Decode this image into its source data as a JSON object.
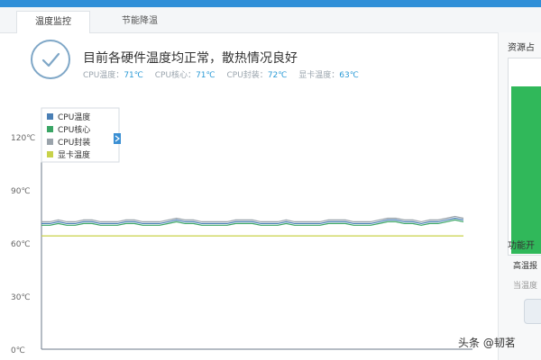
{
  "subtabs": [
    "温度监控",
    "节能降温"
  ],
  "status": {
    "message": "目前各硬件温度均正常，散热情况良好",
    "readings": [
      {
        "label": "CPU温度：",
        "value": "71℃"
      },
      {
        "label": "CPU核心：",
        "value": "71℃"
      },
      {
        "label": "CPU封装：",
        "value": "72℃"
      },
      {
        "label": "显卡温度：",
        "value": "63℃"
      }
    ]
  },
  "right_panel": {
    "title": "资源占",
    "title2": "功能开",
    "item1": "高温报",
    "item2": "当温度"
  },
  "watermark": "头条 @韧茗",
  "chart_data": {
    "type": "line",
    "ytick_labels": [
      "120℃",
      "90℃",
      "60℃",
      "30℃",
      "0℃"
    ],
    "ylim": [
      0,
      120
    ],
    "grid": false,
    "legend_placement": "top-left",
    "series": [
      {
        "name": "CPU温度",
        "color": "#4a7fb5",
        "values": [
          71,
          71,
          72,
          71,
          71,
          72,
          72,
          71,
          71,
          71,
          72,
          72,
          71,
          71,
          71,
          72,
          73,
          72,
          72,
          71,
          71,
          71,
          71,
          72,
          72,
          72,
          71,
          71,
          71,
          72,
          71,
          71,
          71,
          71,
          72,
          72,
          72,
          71,
          71,
          71,
          72,
          73,
          73,
          72,
          72,
          71,
          72,
          72,
          73,
          74,
          73
        ]
      },
      {
        "name": "CPU核心",
        "color": "#3aa565",
        "values": [
          70,
          70,
          71,
          70,
          70,
          71,
          71,
          70,
          70,
          70,
          71,
          71,
          70,
          70,
          70,
          71,
          72,
          71,
          71,
          70,
          70,
          70,
          70,
          71,
          71,
          71,
          70,
          70,
          70,
          71,
          70,
          70,
          70,
          70,
          71,
          71,
          71,
          70,
          70,
          70,
          71,
          72,
          72,
          71,
          71,
          70,
          71,
          71,
          72,
          73,
          72
        ]
      },
      {
        "name": "CPU封装",
        "color": "#9aa3ab",
        "values": [
          72,
          72,
          73,
          72,
          72,
          73,
          73,
          72,
          72,
          72,
          73,
          73,
          72,
          72,
          72,
          73,
          74,
          73,
          73,
          72,
          72,
          72,
          72,
          73,
          73,
          73,
          72,
          72,
          72,
          73,
          72,
          72,
          72,
          72,
          73,
          73,
          73,
          72,
          72,
          72,
          73,
          74,
          74,
          73,
          73,
          72,
          73,
          73,
          74,
          75,
          74
        ]
      },
      {
        "name": "显卡温度",
        "color": "#c8d24a",
        "values": [
          64,
          64,
          64,
          64,
          64,
          64,
          64,
          64,
          64,
          64,
          64,
          64,
          64,
          64,
          64,
          64,
          64,
          64,
          64,
          64,
          64,
          64,
          64,
          64,
          64,
          64,
          64,
          64,
          64,
          64,
          64,
          64,
          64,
          64,
          64,
          64,
          64,
          64,
          64,
          64,
          64,
          64,
          64,
          64,
          64,
          64,
          64,
          64,
          64,
          64,
          64
        ]
      }
    ]
  }
}
